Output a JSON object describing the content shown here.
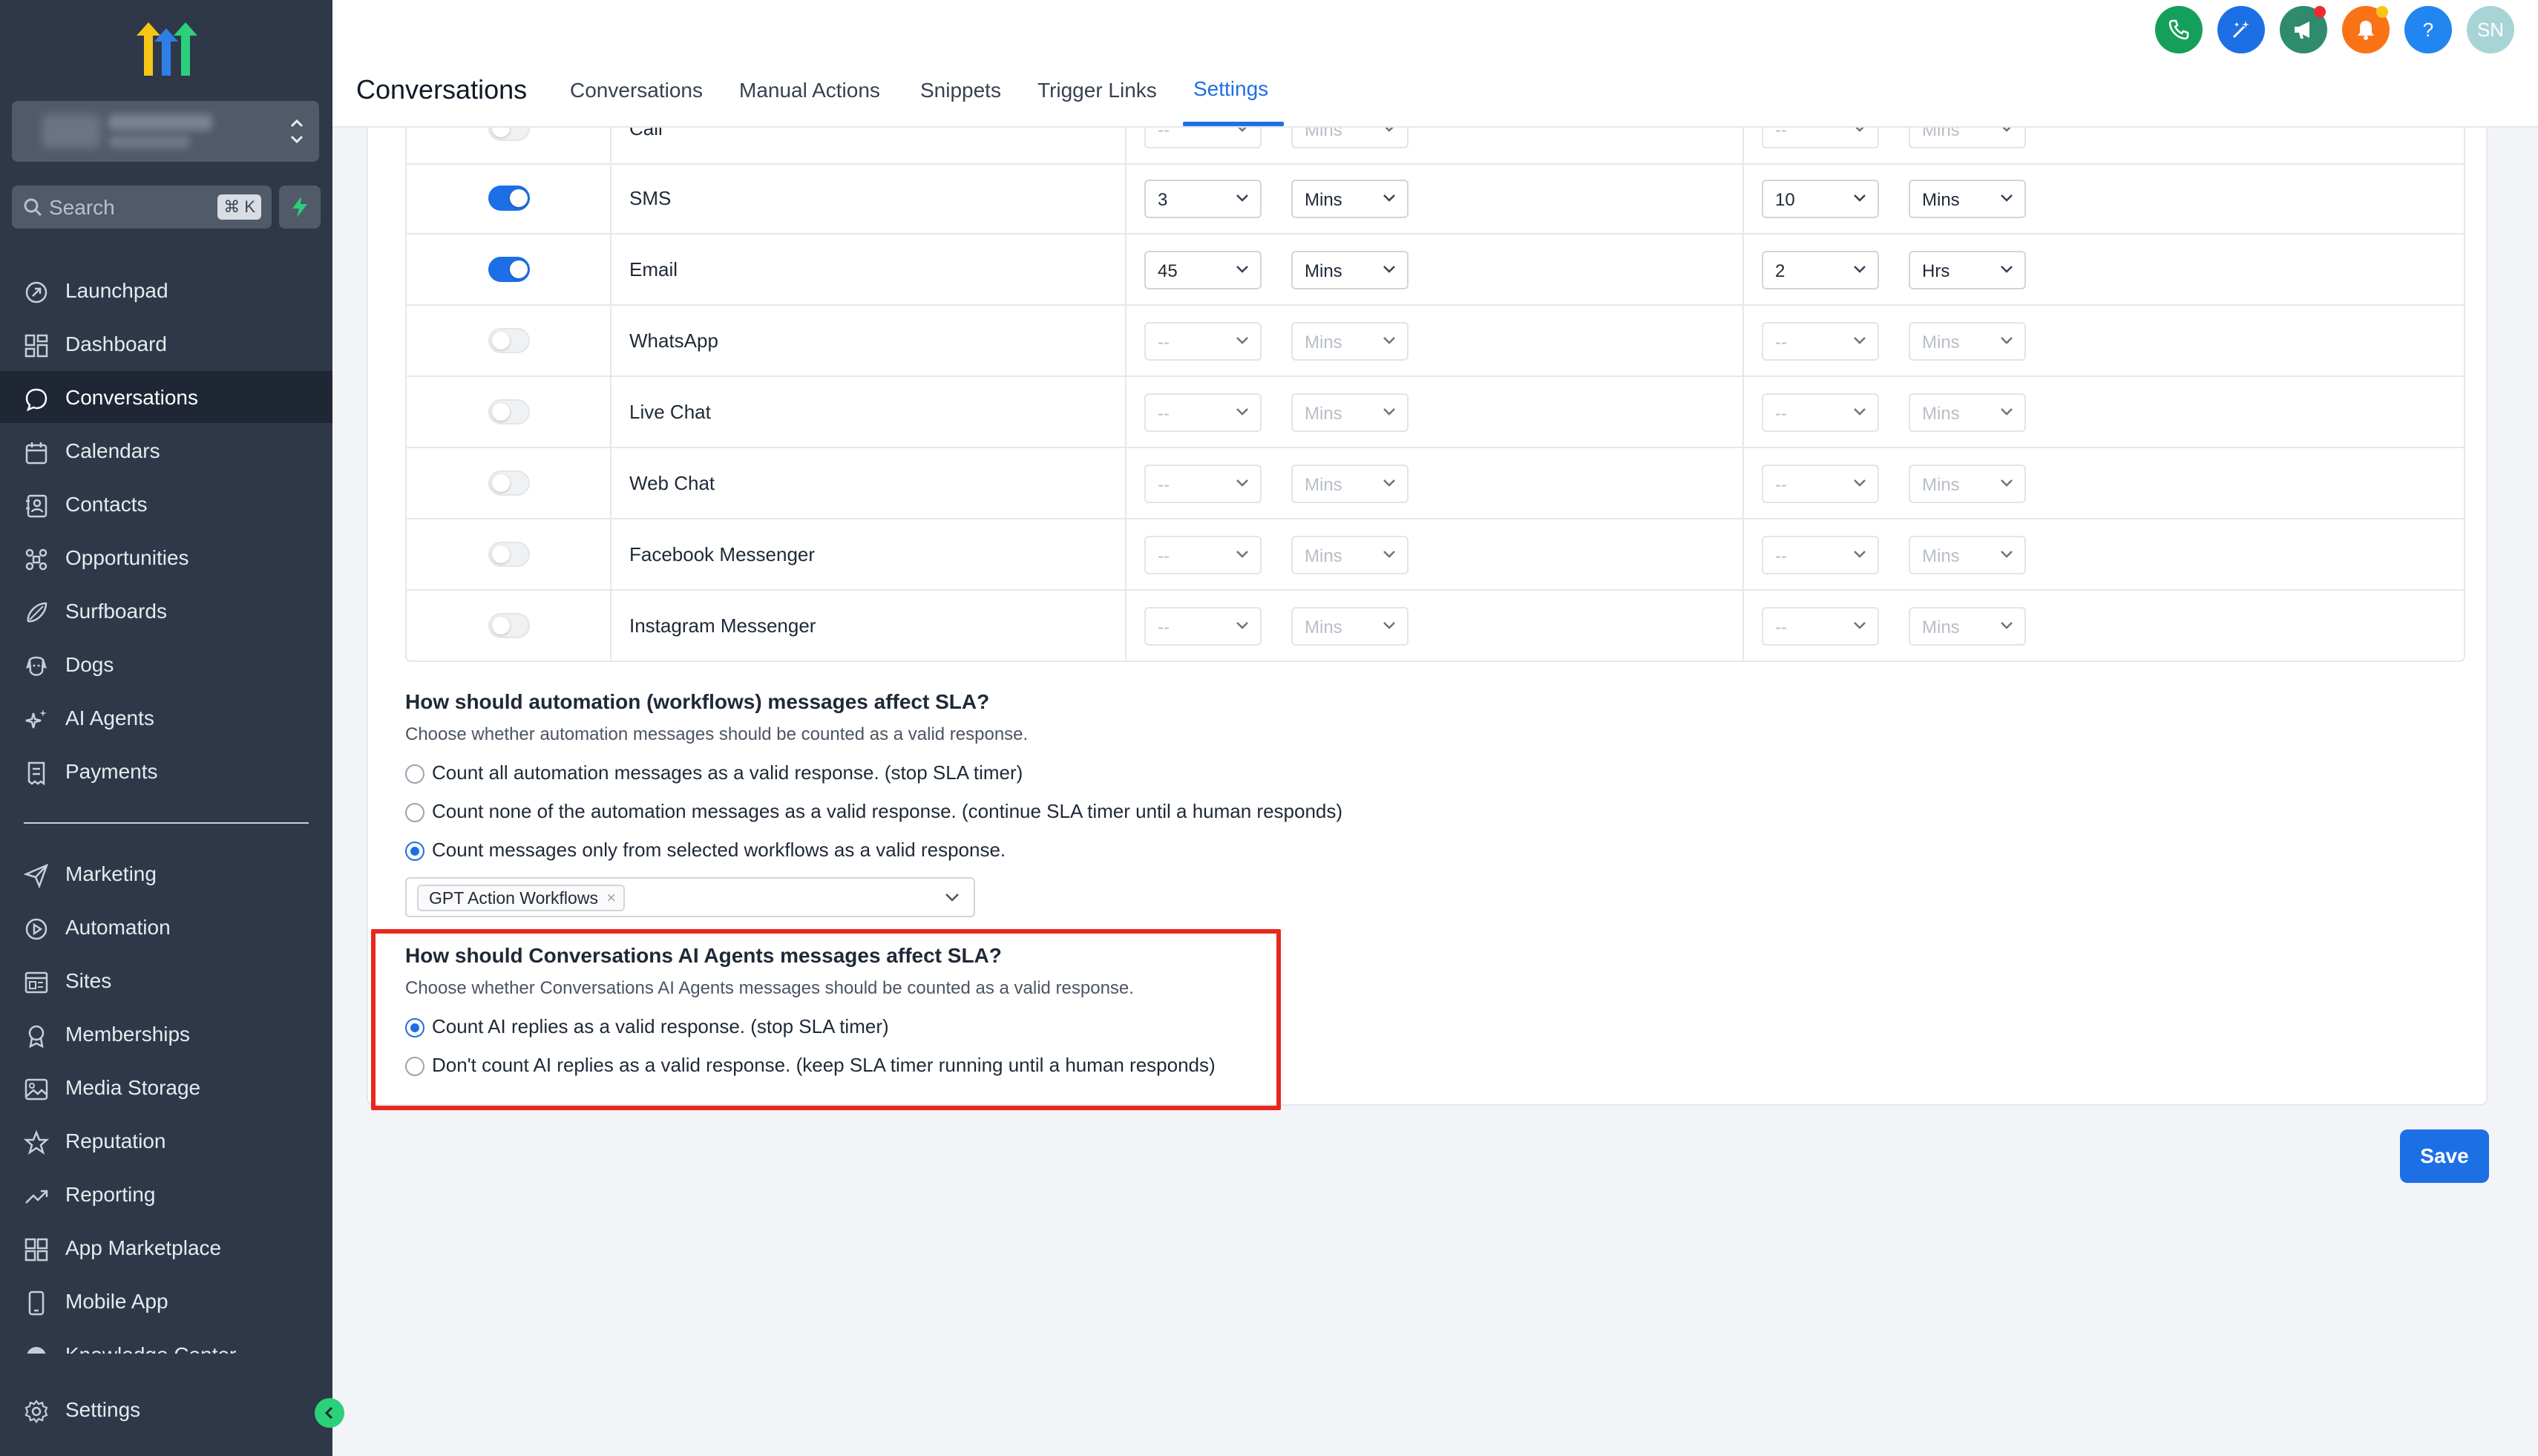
{
  "sidebar": {
    "account_name": "Blurred account",
    "search": {
      "label": "Search",
      "shortcut": "⌘ K"
    },
    "items_top": [
      {
        "label": "Launchpad",
        "icon": "rocket-icon"
      },
      {
        "label": "Dashboard",
        "icon": "grid-icon"
      },
      {
        "label": "Conversations",
        "icon": "chat-icon",
        "active": true
      },
      {
        "label": "Calendars",
        "icon": "calendar-icon"
      },
      {
        "label": "Contacts",
        "icon": "contacts-icon"
      },
      {
        "label": "Opportunities",
        "icon": "opportunities-icon"
      },
      {
        "label": "Surfboards",
        "icon": "surfboard-icon"
      },
      {
        "label": "Dogs",
        "icon": "dog-icon"
      },
      {
        "label": "AI Agents",
        "icon": "sparkle-icon"
      },
      {
        "label": "Payments",
        "icon": "receipt-icon"
      }
    ],
    "items_bottom": [
      {
        "label": "Marketing",
        "icon": "send-icon"
      },
      {
        "label": "Automation",
        "icon": "automation-icon"
      },
      {
        "label": "Sites",
        "icon": "sites-icon"
      },
      {
        "label": "Memberships",
        "icon": "memberships-icon"
      },
      {
        "label": "Media Storage",
        "icon": "image-icon"
      },
      {
        "label": "Reputation",
        "icon": "star-icon"
      },
      {
        "label": "Reporting",
        "icon": "trend-icon"
      },
      {
        "label": "App Marketplace",
        "icon": "apps-icon"
      },
      {
        "label": "Mobile App",
        "icon": "mobile-icon"
      },
      {
        "label": "Knowledge Center",
        "icon": "book-icon"
      }
    ],
    "settings_label": "Settings"
  },
  "header": {
    "title": "Conversations",
    "tabs": [
      "Conversations",
      "Manual Actions",
      "Snippets",
      "Trigger Links",
      "Settings"
    ],
    "active_tab": "Settings",
    "avatar_initials": "SN",
    "buttons": [
      {
        "icon": "phone-icon",
        "color": "#14a05a"
      },
      {
        "icon": "magic-wand-icon",
        "color": "#1d6fe6"
      },
      {
        "icon": "megaphone-icon",
        "color": "#2e8b6e"
      },
      {
        "icon": "bell-icon",
        "color": "#f97316"
      },
      {
        "icon": "help-icon",
        "color": "#2186f0"
      }
    ]
  },
  "sla_table": {
    "partial_row": {
      "channel": "Call",
      "first_value": "--",
      "first_unit": "Mins",
      "second_value": "--",
      "second_unit": "Mins",
      "enabled": false
    },
    "rows": [
      {
        "channel": "SMS",
        "enabled": true,
        "first_value": "3",
        "first_unit": "Mins",
        "second_value": "10",
        "second_unit": "Mins"
      },
      {
        "channel": "Email",
        "enabled": true,
        "first_value": "45",
        "first_unit": "Mins",
        "second_value": "2",
        "second_unit": "Hrs"
      },
      {
        "channel": "WhatsApp",
        "enabled": false,
        "first_value": "--",
        "first_unit": "Mins",
        "second_value": "--",
        "second_unit": "Mins"
      },
      {
        "channel": "Live Chat",
        "enabled": false,
        "first_value": "--",
        "first_unit": "Mins",
        "second_value": "--",
        "second_unit": "Mins"
      },
      {
        "channel": "Web Chat",
        "enabled": false,
        "first_value": "--",
        "first_unit": "Mins",
        "second_value": "--",
        "second_unit": "Mins"
      },
      {
        "channel": "Facebook Messenger",
        "enabled": false,
        "first_value": "--",
        "first_unit": "Mins",
        "second_value": "--",
        "second_unit": "Mins"
      },
      {
        "channel": "Instagram Messenger",
        "enabled": false,
        "first_value": "--",
        "first_unit": "Mins",
        "second_value": "--",
        "second_unit": "Mins"
      }
    ]
  },
  "automation": {
    "title": "How should automation (workflows) messages affect SLA?",
    "description": "Choose whether automation messages should be counted as a valid response.",
    "options": [
      {
        "label": "Count all automation messages as a valid response. (stop SLA timer)",
        "checked": false
      },
      {
        "label": "Count none of the automation messages as a valid response. (continue SLA timer until a human responds)",
        "checked": false
      },
      {
        "label": "Count messages only from selected workflows as a valid response.",
        "checked": true
      }
    ],
    "selected_workflows": [
      "GPT Action Workflows"
    ]
  },
  "ai_agents": {
    "title": "How should Conversations AI Agents messages affect SLA?",
    "description": "Choose whether Conversations AI Agents messages should be counted as a valid response.",
    "options": [
      {
        "label": "Count AI replies as a valid response. (stop SLA timer)",
        "checked": true
      },
      {
        "label": "Don't count AI replies as a valid response. (keep SLA timer running until a human responds)",
        "checked": false
      }
    ]
  },
  "save_label": "Save",
  "colors": {
    "accent": "#1d6fe6",
    "sidebar": "#2e3848",
    "highlight": "#e8281e"
  }
}
